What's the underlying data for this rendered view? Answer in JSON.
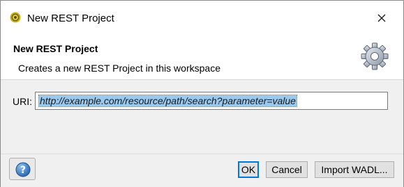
{
  "window": {
    "title": "New REST Project",
    "app_icon": "soapui-icon",
    "close_icon": "close-icon"
  },
  "header": {
    "heading": "New REST Project",
    "description": "Creates a new REST Project in this workspace",
    "icon": "gear-icon"
  },
  "form": {
    "uri_label": "URI:",
    "uri_value": "http://example.com/resource/path/search?parameter=value",
    "uri_value_selected": true
  },
  "footer": {
    "help_icon": "help-icon",
    "ok_label": "OK",
    "cancel_label": "Cancel",
    "import_label": "Import WADL..."
  },
  "colors": {
    "selection": "#99c9ef",
    "default_button_border": "#0078d7",
    "panel_background": "#f0f0f0",
    "help_icon_blue": "#2f6fb6"
  }
}
